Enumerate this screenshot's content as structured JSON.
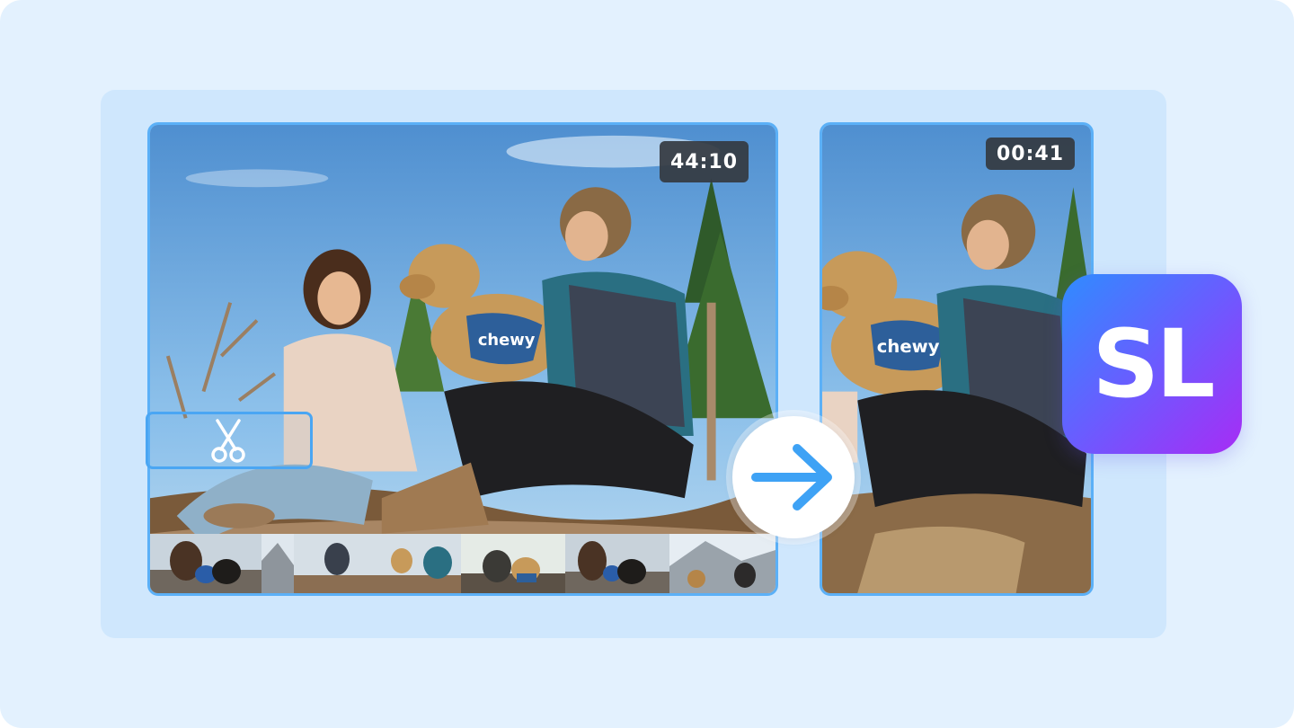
{
  "source_video": {
    "duration": "44:10"
  },
  "output_clip": {
    "duration": "00:41"
  },
  "filmstrip": {
    "selected_range_fraction": [
      0.23,
      0.5
    ]
  },
  "brand": {
    "logo_text": "SL",
    "accent_color": "#5bb0f7",
    "logo_gradient": [
      "#2f8cff",
      "#6a5cff",
      "#a72cf5"
    ]
  },
  "icons": {
    "cut": "scissors-icon",
    "convert": "arrow-right-icon"
  }
}
